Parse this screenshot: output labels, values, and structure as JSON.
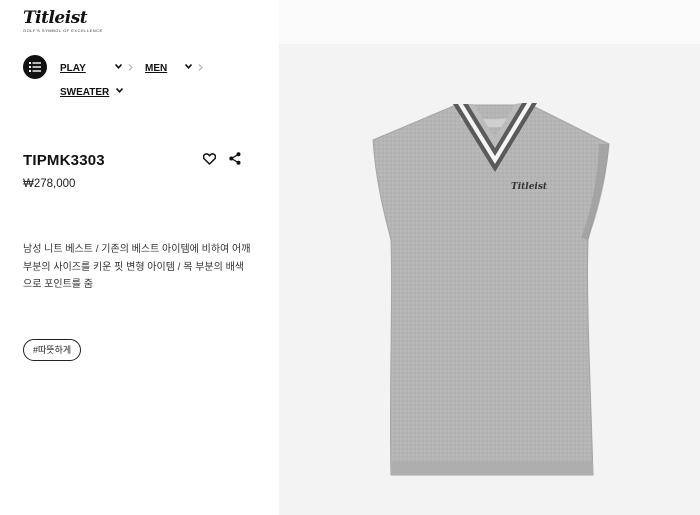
{
  "brand": {
    "logo_text": "Titleist",
    "tagline": "GOLF'S SYMBOL OF EXCELLENCE"
  },
  "breadcrumb": {
    "items": [
      "PLAY",
      "MEN",
      "SWEATER"
    ]
  },
  "product": {
    "sku": "TIPMK3303",
    "price": "₩278,000",
    "description": "남성 니트 베스트 / 기존의 베스트 아이템에 비하여 어깨 부분의 사이즈를 키운 핏 변형 아이템 / 목 부분의 배색으로 포인트를 줌",
    "tags": [
      "#따뜻하게"
    ],
    "garment_logo": "Titleist"
  },
  "icons": {
    "menu": "list-icon",
    "chevron": "chevron-down-icon",
    "separator": "chevron-right-icon",
    "wishlist": "heart-icon",
    "share": "share-icon"
  },
  "colors": {
    "background_left": "#ffffff",
    "background_right": "#f3f3f3",
    "knit_gray": "#b4b4b4",
    "stripe_dark": "#5a5a5a"
  }
}
